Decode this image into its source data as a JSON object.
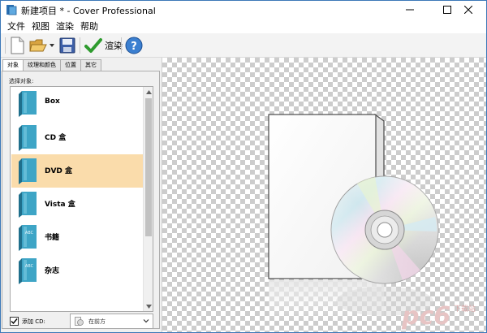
{
  "window": {
    "title": "新建项目 * - Cover Professional",
    "min_glyph": "─",
    "max_glyph": "☐",
    "close_glyph": "✕"
  },
  "menu": [
    "文件",
    "视图",
    "渲染",
    "帮助"
  ],
  "toolbar": {
    "render_label": "渲染",
    "icons": [
      "new-file-icon",
      "open-folder-icon",
      "save-disk-icon",
      "render-check-icon",
      "help-icon"
    ]
  },
  "left_panel": {
    "tabs": [
      "对象",
      "纹理和颜色",
      "位置",
      "其它"
    ],
    "active_tab": 0,
    "select_label": "选择对象:",
    "items": [
      {
        "label": "Box",
        "icon": "box-cover-icon",
        "glyph": ""
      },
      {
        "label": "CD 盒",
        "icon": "cd-case-cover-icon",
        "glyph": ""
      },
      {
        "label": "DVD 盒",
        "icon": "dvd-case-cover-icon",
        "glyph": ""
      },
      {
        "label": "Vista 盒",
        "icon": "vista-box-cover-icon",
        "glyph": ""
      },
      {
        "label": "书籍",
        "icon": "book-cover-icon",
        "glyph": "ABC"
      },
      {
        "label": "杂志",
        "icon": "magazine-cover-icon",
        "glyph": "ABC"
      }
    ],
    "selected_index": 2,
    "add_cd_label": "添加 CD:",
    "add_cd_checked": true,
    "cd_style_value": "在前方"
  },
  "colors": {
    "selection": "#fadcab",
    "book_teal": "#3ea5c6",
    "accent_blue": "#3c78b8"
  },
  "watermark": {
    "brand": "pc6",
    "tagline": "下载站"
  }
}
